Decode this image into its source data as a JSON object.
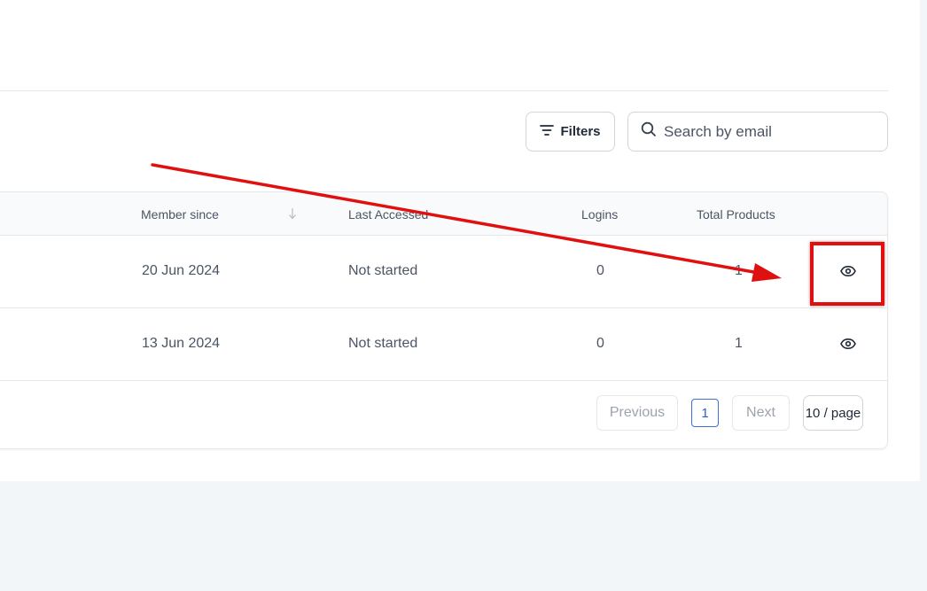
{
  "toolbar": {
    "filters_label": "Filters",
    "search_placeholder": "Search by email"
  },
  "table": {
    "columns": {
      "member_since": "Member since",
      "last_accessed": "Last Accessed",
      "logins": "Logins",
      "total_products": "Total Products"
    },
    "rows": [
      {
        "member_since": "20 Jun 2024",
        "last_accessed": "Not started",
        "logins": "0",
        "total_products": "1"
      },
      {
        "member_since": "13 Jun 2024",
        "last_accessed": "Not started",
        "logins": "0",
        "total_products": "1"
      }
    ]
  },
  "pagination": {
    "previous_label": "Previous",
    "current_page": "1",
    "next_label": "Next",
    "page_size": "10 / page"
  },
  "annotation": {
    "color": "#e01010"
  },
  "icons": [
    "filter-icon",
    "search-icon",
    "sort-arrow-down-icon",
    "eye-icon"
  ]
}
